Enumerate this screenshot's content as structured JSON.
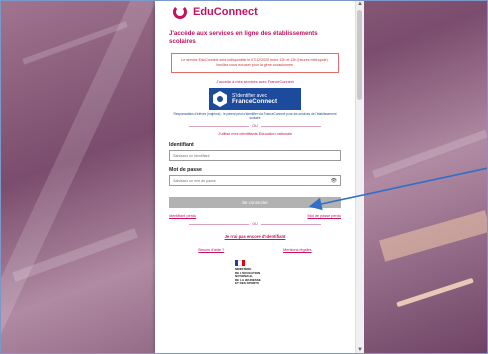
{
  "brand": {
    "name": "EduConnect",
    "accent": "#c4125e",
    "fc_blue": "#1c4a9c"
  },
  "headline": "J'accède aux services en ligne des établissements scolaires",
  "notice": "Le service EduConnect sera indisponible le 07/12/2020 entre 12h et 13h (heures métropole). Veuillez nous excuser pour la gêne occasionnée.",
  "franceconnect": {
    "prompt": "J'accède à mes services avec FranceConnect",
    "button_line1": "S'identifier avec",
    "button_line2": "FranceConnect",
    "link": "Responsables d'élèves (majeurs) : le parent peut s'identifier via FranceConnect pour les services de l'établissement scolaire"
  },
  "divider_text": "OU",
  "edu_prompt": "J'utilise mes identifiants Éducation nationale",
  "login": {
    "identifiant_label": "Identifiant",
    "identifiant_placeholder": "Saisissez un identifiant",
    "password_label": "Mot de passe",
    "password_placeholder": "Saisissez un mot de passe",
    "eye_icon": "eye-icon",
    "submit": "Se connecter",
    "forgot_id": "Identifiant perdu",
    "forgot_pw": "Mot de passe perdu"
  },
  "activate": "Je n'ai pas encore d'identifiant",
  "help": {
    "aide": "Besoin d'aide ?",
    "legal": "Mentions légales"
  },
  "ministry": {
    "line1": "MINISTÈRE",
    "line2": "DE L'ÉDUCATION",
    "line3": "NATIONALE,",
    "line4": "DE LA JEUNESSE",
    "line5": "ET DES SPORTS"
  },
  "annotation": {
    "arrow_color": "#2f6fc8"
  }
}
